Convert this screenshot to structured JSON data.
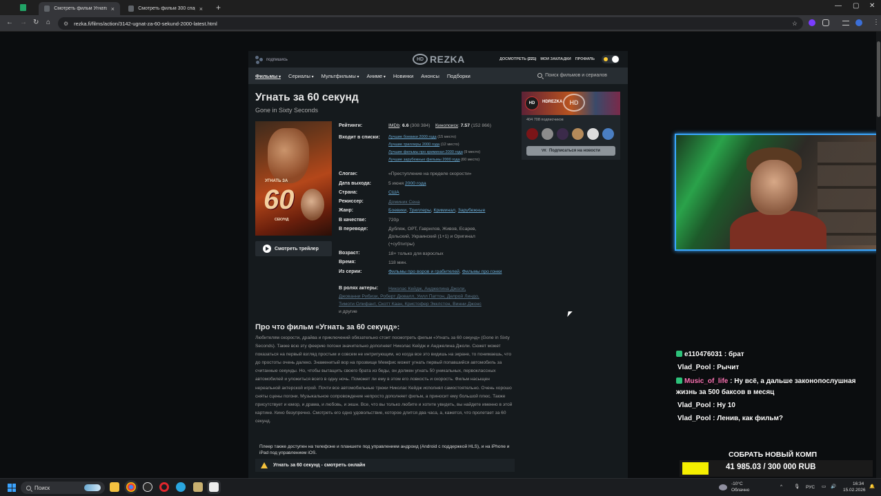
{
  "browser": {
    "tabs": [
      {
        "title": "Смотреть фильм Угнать за 60 с",
        "active": true
      },
      {
        "title": "Смотреть фильм 300 спартанц",
        "active": false
      }
    ],
    "url": "rezka.fi/films/action/3142-ugnat-za-60-sekund-2000-latest.html"
  },
  "site": {
    "subscribe": "подпишись",
    "logo_hd": "HD",
    "logo_text": "REZKA",
    "header_links": {
      "watch_later": "ДОСМОТРЕТЬ",
      "watch_later_count": "(221)",
      "bookmarks": "МОИ ЗАКЛАДКИ",
      "profile": "ПРОФИЛЬ"
    },
    "nav": [
      "Фильмы",
      "Сериалы",
      "Мультфильмы",
      "Аниме",
      "Новинки",
      "Анонсы",
      "Подборки"
    ],
    "search_placeholder": "Поиск фильмов и сериалов"
  },
  "film": {
    "title": "Угнать за 60 секунд",
    "original_title": "Gone in Sixty Seconds",
    "poster_top": "УГНАТЬ ЗА",
    "poster_num": "60",
    "poster_bottom": "СЕКУНД",
    "trailer_button": "Смотреть трейлер",
    "labels": {
      "ratings": "Рейтинги:",
      "lists": "Входит в списки:",
      "slogan": "Слоган:",
      "release": "Дата выхода:",
      "country": "Страна:",
      "director": "Режиссер:",
      "genre": "Жанр:",
      "quality": "В качестве:",
      "translation": "В переводе:",
      "age": "Возраст:",
      "time": "Время:",
      "series": "Из серии:",
      "actors": "В ролях актеры:"
    },
    "ratings": {
      "imdb_label": "IMDb",
      "imdb_value": "6.6",
      "imdb_votes": "(308 384)",
      "kp_label": "Кинопоиск",
      "kp_value": "7.57",
      "kp_votes": "(152 866)"
    },
    "lists": [
      {
        "name": "Лучшие боевики 2000 года",
        "place": "(15 место)"
      },
      {
        "name": "Лучшие триллеры 2000 года",
        "place": "(12 место)"
      },
      {
        "name": "Лучшие фильмы про криминал 2000 года",
        "place": "(9 место)"
      },
      {
        "name": "Лучшие зарубежные фильмы 2000 года",
        "place": "(60 место)"
      }
    ],
    "slogan": "«Преступление на пределе скорости»",
    "release_day": "5 июня",
    "release_year": "2000 года",
    "country": "США",
    "director": "Доминик Сена",
    "genres": [
      "Боевики",
      "Триллеры",
      "Криминал",
      "Зарубежные"
    ],
    "quality": "720p",
    "translation": "Дубляж, ОРТ, Гаврилов, Живов, Есарев, Дольский, Украинский (1+1) и Оригинал (+субтитры)",
    "age_value": "18+",
    "age_text": "только для взрослых",
    "time": "118 мин.",
    "series": [
      "Фильмы про воров и грабителей",
      "Фильмы про гонки"
    ],
    "actors_line1": "Николас Кейдж, Анджелина Джоли,",
    "actors_line2": "Джованни Рибизи, Роберт Дювалл, Уилл Паттон, Делрой Линдо,",
    "actors_line3": "Тимоти Олифант, Скотт Каан, Кристофер Экклстон, Винни Джонс",
    "actors_more": "и другие",
    "about_title": "Про что фильм «Угнать за 60 секунд»:",
    "about_text": "Любителям скорости, драйва и приключений обязательно стоит посмотреть фильм «Угнать за 60 секунд» (Gone in Sixty Seconds). Также всю эту феерию погони значительно дополняет Николас Кейдж и Анджелина Джоли. Сюжет может показаться на первый взгляд простым и совсем не интригующим, но когда все это видишь на экране, то понимаешь, что до простоты очень далеко. Знаменитый вор на прозвище Мемфис может угнать первый попавшийся автомобиль за считанные секунды. Но, чтобы вытащить своего брата из беды, он должен угнать 50 уникальных, первоклассных автомобилей и уложиться всего в одну ночь. Поможет ли ему в этом его ловкость и скорость. Фильм насыщен нереальной актерской игрой. Почти все автомобильные трюки Николас Кейдж исполнял самостоятельно. Очень хорошо сняты сцены погони. Музыкальное сопровождение непросто дополняет фильм, а приносит ему большой плюс. Также присутствует и юмор, и драма, и любовь, и экшн. Все, что вы только любите и хотите увидеть, вы найдете именно в этой картине. Кино безупречно. Смотреть его одно удовольствие, которое длится два часа, а, кажется, что пролетает за 60 секунд.",
    "player_note": "Плеер также доступен на телефоне и планшете под управлением андроид (Android с поддержкой HLS), и на iPhone и iPad под управлением iOS.",
    "watch_online": "Угнать за 60 секунд - смотреть онлайн"
  },
  "telegram": {
    "avatar": "HD",
    "name": "HDREZKA",
    "banner_logo": "HD",
    "subscribers": "404 708 подписчиков",
    "button": "Подписаться на новости",
    "button_icon": "vk-icon"
  },
  "stream": {
    "chat": [
      {
        "user": "e110476031",
        "text": " : брат",
        "badge": true,
        "color": "#ffffff"
      },
      {
        "user": "Vlad_Pool",
        "text": " : Рычит",
        "badge": false,
        "color": "#ffffff"
      },
      {
        "user": "Music_of_life",
        "text": " : Ну всё, а дальше законопослушная",
        "text2": "жизнь за 500 баксов в месяц",
        "badge": true,
        "color": "#ff77b8"
      },
      {
        "user": "Vlad_Pool",
        "text": " : Ну 10",
        "badge": false,
        "color": "#ffffff"
      },
      {
        "user": "Vlad_Pool",
        "text": " : Ленив, как фильм?",
        "badge": false,
        "color": "#ffffff"
      }
    ],
    "goal_title": "СОБРАТЬ НОВЫЙ КОМП",
    "goal_value": "41 985.03 / 300 000 RUB",
    "goal_fraction": 0.14
  },
  "taskbar": {
    "search": "Поиск",
    "weather_temp": "-10°C",
    "weather_text": "Облачно",
    "lang": "РУС",
    "time": "16:34",
    "date": "15.02.2026"
  },
  "colors": {
    "accent_link": "#6aa9d1",
    "goal_fill": "#f5ef00",
    "cam_border": "#3aa7ff"
  }
}
